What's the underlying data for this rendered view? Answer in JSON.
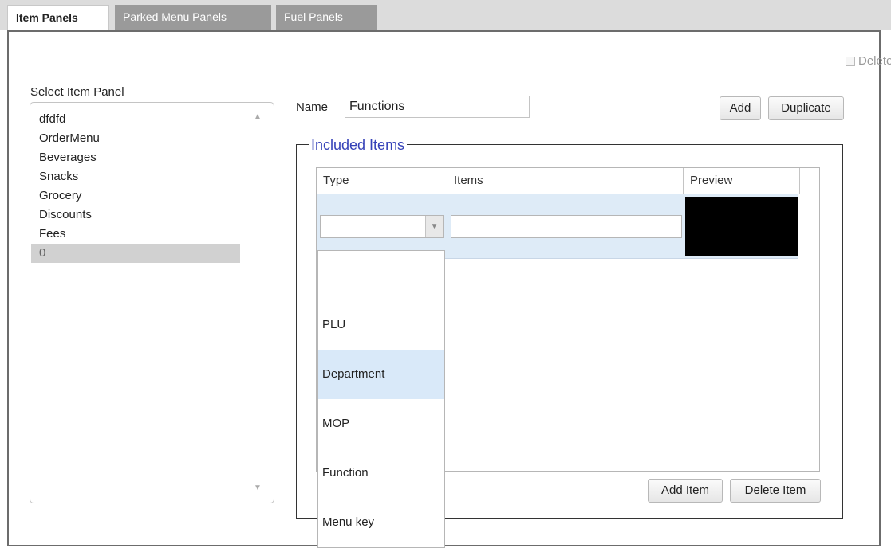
{
  "tabs": [
    {
      "label": "Item Panels",
      "active": true
    },
    {
      "label": "Parked Menu Panels",
      "active": false
    },
    {
      "label": "Fuel Panels",
      "active": false
    }
  ],
  "delete_label": "Delete",
  "panel_list": {
    "label": "Select Item Panel",
    "items": [
      "dfdfd",
      "OrderMenu",
      "Beverages",
      "Snacks",
      "Grocery",
      "Discounts",
      "Fees",
      "0"
    ],
    "selected": "0"
  },
  "name_field": {
    "label": "Name",
    "value": "Functions"
  },
  "buttons": {
    "add": "Add",
    "duplicate": "Duplicate",
    "add_item": "Add Item",
    "delete_item": "Delete Item"
  },
  "included": {
    "legend": "Included Items",
    "columns": [
      "Type",
      "Items",
      "Preview"
    ],
    "row": {
      "type": "",
      "items": ""
    }
  },
  "type_dropdown": {
    "options": [
      "",
      "PLU",
      "Department",
      "MOP",
      "Function",
      "Menu key"
    ],
    "highlighted": "Department"
  },
  "colors": {
    "accent": "#3441b8",
    "selected_row": "#d1d1d1",
    "highlight": "#d9e9f9",
    "tab_inactive": "#9a9a9a"
  }
}
